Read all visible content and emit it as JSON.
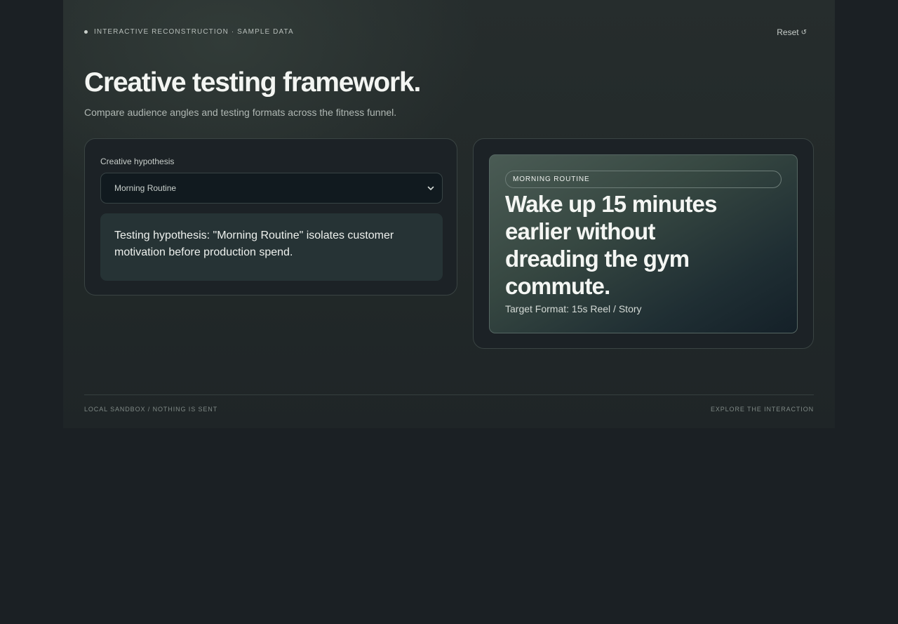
{
  "header": {
    "eyebrow": "INTERACTIVE RECONSTRUCTION · SAMPLE DATA",
    "reset_label": "Reset",
    "reset_icon": "↺"
  },
  "hero": {
    "title": "Creative testing framework.",
    "subtitle": "Compare audience angles and testing formats across the fitness funnel."
  },
  "controls": {
    "field_label": "Creative hypothesis",
    "selected_option": "Morning Routine",
    "hypothesis_text": "Testing hypothesis: \"Morning Routine\" isolates customer motivation before production spend."
  },
  "preview": {
    "tag": "MORNING ROUTINE",
    "headline": "Wake up 15 minutes earlier without dreading the gym commute.",
    "format": "Target Format: 15s Reel / Story"
  },
  "footer": {
    "left": "LOCAL SANDBOX / NOTHING IS SENT",
    "right": "EXPLORE THE INTERACTION"
  },
  "colors": {
    "background": "#1b2024",
    "panel": "#1c2226",
    "text": "#f3f5f2"
  }
}
